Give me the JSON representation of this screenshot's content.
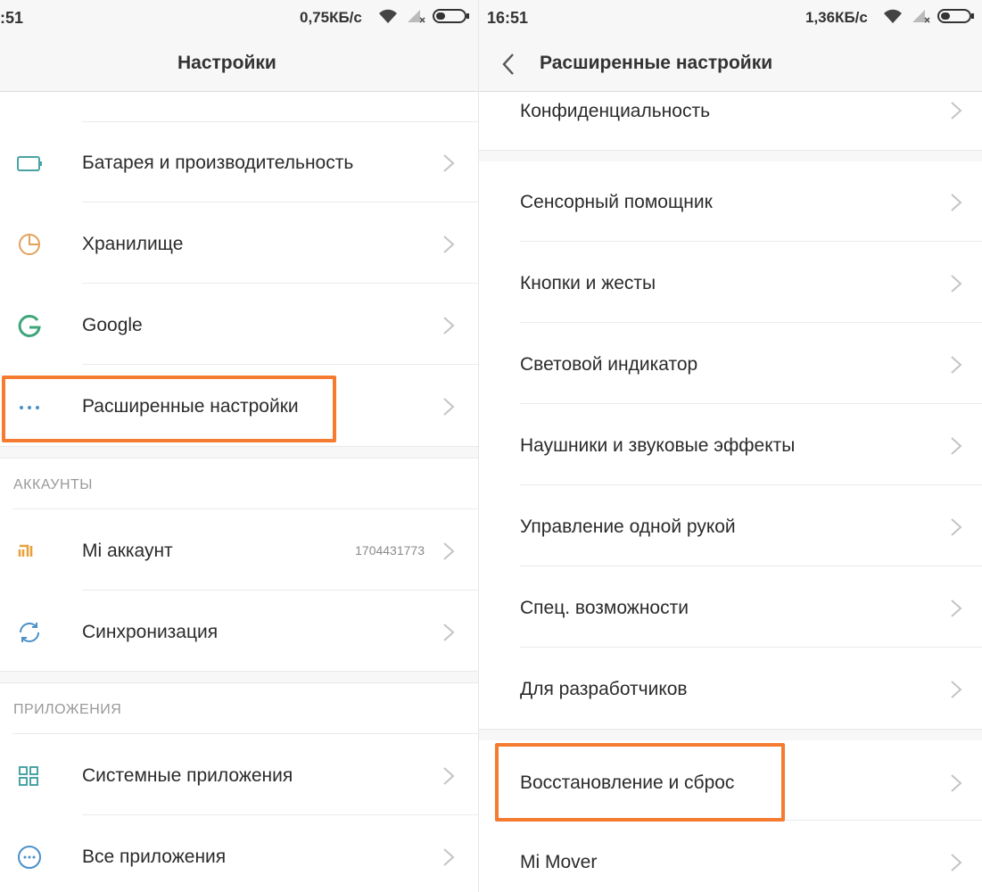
{
  "left": {
    "status": {
      "time": ":51",
      "speed": "0,75КБ/с"
    },
    "title": "Настройки",
    "items": [
      {
        "label": "Батарея и производительность",
        "icon": "battery-icon"
      },
      {
        "label": "Хранилище",
        "icon": "storage-pie-icon"
      },
      {
        "label": "Google",
        "icon": "google-icon"
      },
      {
        "label": "Расширенные настройки",
        "icon": "more-dots-icon"
      }
    ],
    "accounts_header": "АККАУНТЫ",
    "accounts": [
      {
        "label": "Mi аккаунт",
        "value": "1704431773",
        "icon": "mi-logo-icon"
      },
      {
        "label": "Синхронизация",
        "icon": "sync-icon"
      }
    ],
    "apps_header": "ПРИЛОЖЕНИЯ",
    "apps": [
      {
        "label": "Системные приложения",
        "icon": "grid-apps-icon"
      },
      {
        "label": "Все приложения",
        "icon": "all-apps-icon"
      }
    ]
  },
  "right": {
    "status": {
      "time": "16:51",
      "speed": "1,36КБ/с"
    },
    "title": "Расширенные настройки",
    "items": [
      {
        "label": "Конфиденциальность"
      },
      {
        "label": "Сенсорный помощник"
      },
      {
        "label": "Кнопки и жесты"
      },
      {
        "label": "Световой индикатор"
      },
      {
        "label": "Наушники и звуковые эффекты"
      },
      {
        "label": "Управление одной рукой"
      },
      {
        "label": "Спец. возможности"
      },
      {
        "label": "Для разработчиков"
      },
      {
        "label": "Восстановление и сброс"
      },
      {
        "label": "Mi Mover"
      }
    ]
  },
  "colors": {
    "highlight": "#f47b30",
    "accent_teal": "#4aa3a3",
    "mi_orange": "#e6a23c"
  }
}
